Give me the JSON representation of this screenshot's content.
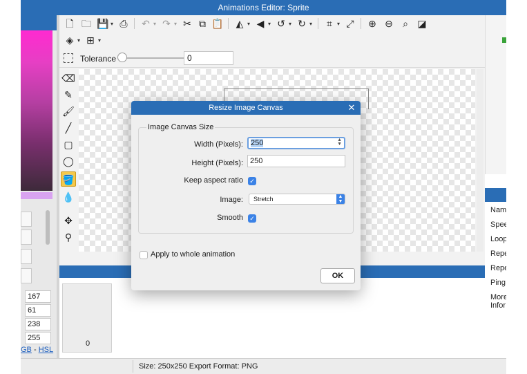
{
  "window": {
    "title": "Animations Editor: Sprite"
  },
  "color_panel": {
    "values": [
      "167",
      "61",
      "238",
      "255"
    ],
    "mode_links": [
      "GB",
      "HSL"
    ],
    "mode_separator": "-"
  },
  "toolbar": {
    "tolerance_label": "Tolerance",
    "tolerance_value": "0",
    "tolerance_level": 0
  },
  "frames": {
    "frame_number": "0"
  },
  "properties": {
    "labels": [
      "Nam",
      "Spee",
      "Loop",
      "Repe",
      "Repe",
      "Ping",
      "More",
      "Infor"
    ]
  },
  "status": {
    "text": "Size: 250x250   Export Format: PNG"
  },
  "dialog": {
    "title": "Resize Image Canvas",
    "close": "✕",
    "group_label": "Image Canvas Size",
    "width_label": "Width (Pixels):",
    "width_value": "250",
    "height_label": "Height (Pixels):",
    "height_value": "250",
    "keep_aspect_label": "Keep aspect ratio",
    "keep_aspect_checked": true,
    "image_label": "Image:",
    "image_option": "Stretch",
    "smooth_label": "Smooth",
    "smooth_checked": true,
    "apply_all_label": "Apply to whole animation",
    "apply_all_checked": false,
    "ok_label": "OK"
  },
  "colors": {
    "accent": "#2a6db5",
    "active_tool": "#f5c84a",
    "checkbox": "#3b82e6"
  }
}
